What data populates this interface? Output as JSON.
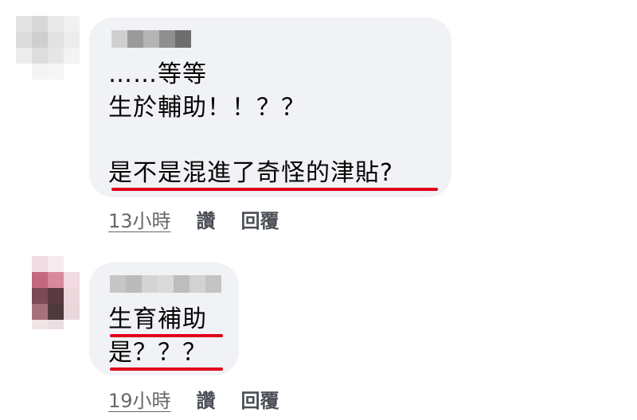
{
  "comments": [
    {
      "lines": [
        "……等等",
        "生於輔助！！？？",
        "是不是混進了奇怪的津貼?"
      ],
      "time": "13小時",
      "like_label": "讚",
      "reply_label": "回覆"
    },
    {
      "lines": [
        "生育補助",
        "是？？？"
      ],
      "time": "19小時",
      "like_label": "讚",
      "reply_label": "回覆"
    }
  ],
  "colors": {
    "bubble": "#f0f2f5",
    "underline": "#e0001a",
    "meta": "#65676b"
  }
}
